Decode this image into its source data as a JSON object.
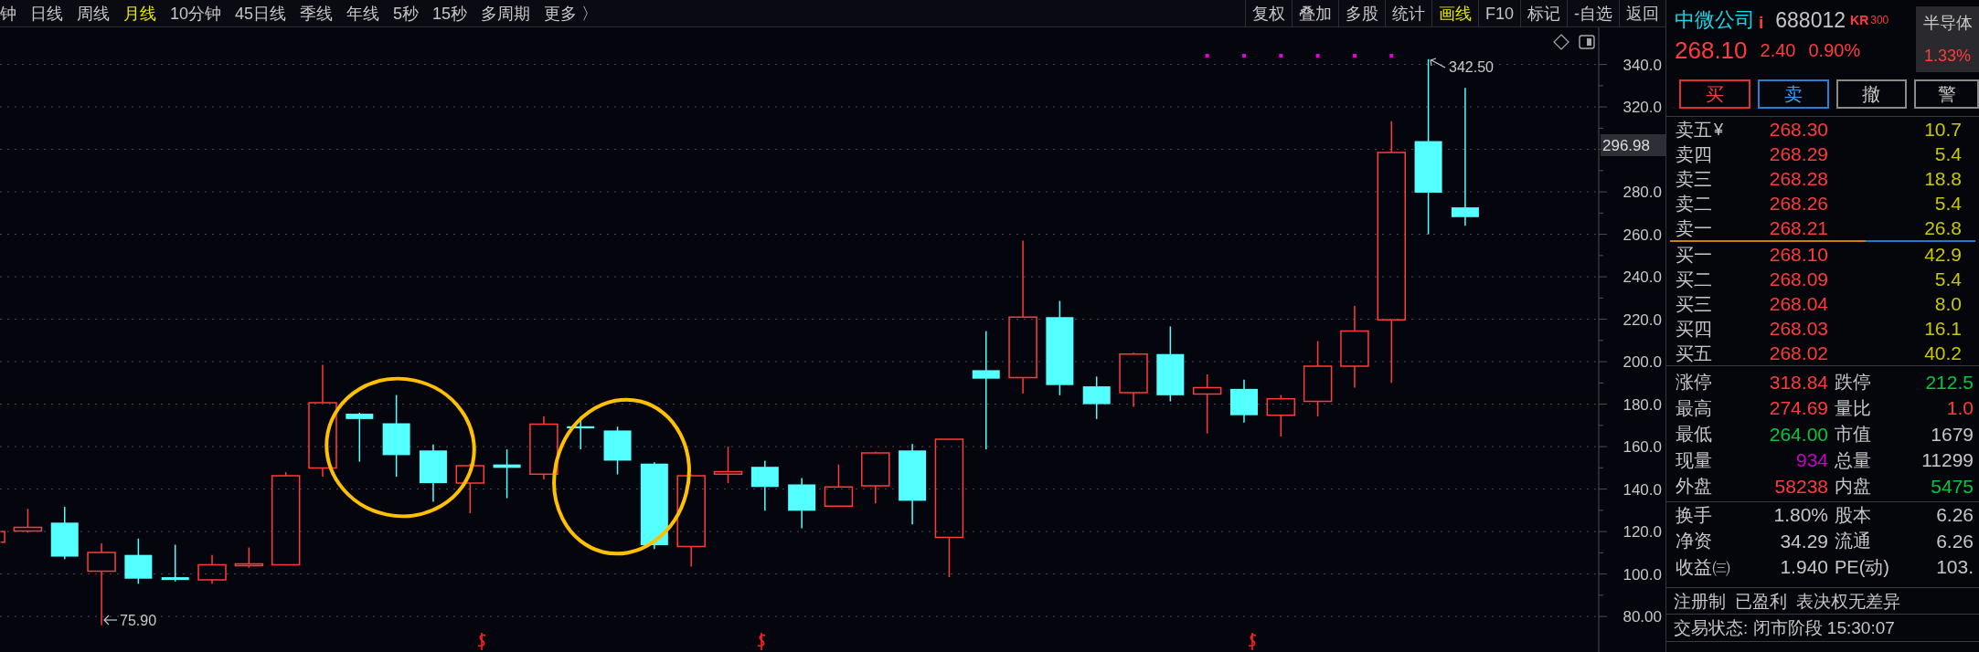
{
  "toolbar": {
    "periods": [
      {
        "label": "钟",
        "selected": false
      },
      {
        "label": "日线",
        "selected": false
      },
      {
        "label": "周线",
        "selected": false
      },
      {
        "label": "月线",
        "selected": true
      },
      {
        "label": "10分钟",
        "selected": false
      },
      {
        "label": "45日线",
        "selected": false
      },
      {
        "label": "季线",
        "selected": false
      },
      {
        "label": "年线",
        "selected": false
      },
      {
        "label": "5秒",
        "selected": false
      },
      {
        "label": "15秒",
        "selected": false
      },
      {
        "label": "多周期",
        "selected": false
      },
      {
        "label": "更多 〉",
        "selected": false
      }
    ],
    "tools": [
      {
        "label": "复权",
        "selected": false
      },
      {
        "label": "叠加",
        "selected": false
      },
      {
        "label": "多股",
        "selected": false
      },
      {
        "label": "统计",
        "selected": false
      },
      {
        "label": "画线",
        "selected": true
      },
      {
        "label": "F10",
        "selected": false
      },
      {
        "label": "标记",
        "selected": false
      },
      {
        "label": "-自选",
        "selected": false
      },
      {
        "label": "返回",
        "selected": false
      }
    ]
  },
  "chart": {
    "axis_labels": [
      "340.0",
      "320.0",
      "280.0",
      "260.0",
      "240.0",
      "220.0",
      "200.0",
      "180.0",
      "160.0",
      "140.0",
      "120.0",
      "100.0",
      "80.00"
    ],
    "current_price": "296.98",
    "high_label": "342.50",
    "low_label": "75.90"
  },
  "quote": {
    "name": "中微公司",
    "info_mark": "i",
    "code": "688012",
    "board": "KR",
    "board_number": "300",
    "price": "268.10",
    "change": "2.40",
    "change_percent": "0.90%",
    "sector": {
      "name": "半导体",
      "change": "1.33%"
    }
  },
  "trade_buttons": [
    {
      "label": "买",
      "kind": "buy"
    },
    {
      "label": "卖",
      "kind": "sell"
    },
    {
      "label": "撤",
      "kind": "cancel"
    },
    {
      "label": "警",
      "kind": "alert"
    }
  ],
  "order_book": {
    "asks": [
      {
        "label": "卖五",
        "currency": "¥",
        "price": "268.30",
        "volume": "10.7"
      },
      {
        "label": "卖四",
        "price": "268.29",
        "volume": "5.4"
      },
      {
        "label": "卖三",
        "price": "268.28",
        "volume": "18.8"
      },
      {
        "label": "卖二",
        "price": "268.26",
        "volume": "5.4"
      },
      {
        "label": "卖一",
        "price": "268.21",
        "volume": "26.8"
      }
    ],
    "ratio": {
      "level": 0.64
    },
    "bids": [
      {
        "label": "买一",
        "price": "268.10",
        "volume": "42.9"
      },
      {
        "label": "买二",
        "price": "268.09",
        "volume": "5.4"
      },
      {
        "label": "买三",
        "price": "268.04",
        "volume": "8.0"
      },
      {
        "label": "买四",
        "price": "268.03",
        "volume": "16.1"
      },
      {
        "label": "买五",
        "price": "268.02",
        "volume": "40.2"
      }
    ]
  },
  "stats": [
    [
      {
        "label": "涨停",
        "value": "318.84",
        "color": "#ff3b3b"
      },
      {
        "label": "跌停",
        "value": "212.5",
        "color": "#00c83c"
      }
    ],
    [
      {
        "label": "最高",
        "value": "274.69",
        "color": "#ff3b3b"
      },
      {
        "label": "量比",
        "value": "1.0",
        "color": "#ff3b3b"
      }
    ],
    [
      {
        "label": "最低",
        "value": "264.00",
        "color": "#00c83c"
      },
      {
        "label": "市值",
        "value": "1679",
        "color": "#c6c6c6"
      }
    ],
    [
      {
        "label": "现量",
        "value": "934",
        "color": "#c800c8"
      },
      {
        "label": "总量",
        "value": "11299",
        "color": "#c6c6c6"
      }
    ],
    [
      {
        "label": "外盘",
        "value": "58238",
        "color": "#ff3b3b"
      },
      {
        "label": "内盘",
        "value": "5475",
        "color": "#00c83c"
      }
    ]
  ],
  "fundamentals": [
    [
      {
        "label": "换手",
        "value": "1.80%",
        "color": "#c6c6c6"
      },
      {
        "label": "股本",
        "value": "6.26",
        "color": "#c6c6c6"
      }
    ],
    [
      {
        "label": "净资",
        "value": "34.29",
        "color": "#c6c6c6"
      },
      {
        "label": "流通",
        "value": "6.26",
        "color": "#c6c6c6"
      }
    ],
    [
      {
        "label": "收益㈢",
        "value": "1.940",
        "color": "#c6c6c6"
      },
      {
        "label": "PE(动)",
        "value": "103.",
        "color": "#c6c6c6"
      }
    ]
  ],
  "tags": [
    "注册制",
    "已盈利",
    "表决权无差异"
  ],
  "status": "交易状态: 闭市阶段 15:30:07"
}
